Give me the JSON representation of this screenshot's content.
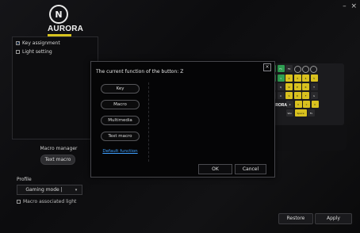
{
  "brand": {
    "logo_letter": "N",
    "name": "AURORA",
    "accent": "#d7c31f"
  },
  "window": {
    "minimize": "–",
    "close": "×"
  },
  "options": [
    {
      "label": "Key assignment",
      "checked": true
    },
    {
      "label": "Light setting",
      "checked": false
    }
  ],
  "macro_manager": {
    "title": "Macro manager",
    "button": "Text macro"
  },
  "profile": {
    "label": "Profile",
    "selected": "Gaming mode |",
    "chevron": "▾"
  },
  "macro_light": {
    "label": "Macro associated light",
    "checked": false
  },
  "footer": {
    "restore": "Restore",
    "apply": "Apply"
  },
  "dialog": {
    "title": "The current function of the button: Z",
    "close": "×",
    "functions": [
      "Key",
      "Macro",
      "Multimedia",
      "Text macro",
      "Default function"
    ],
    "active_function": "Default function",
    "ok": "OK",
    "cancel": "Cancel"
  },
  "keyboard": {
    "brand": "AURORA",
    "row1": [
      "Esc",
      "F1",
      "F2",
      "F3",
      "F4",
      "F5"
    ],
    "row2": [
      "~",
      "1",
      "2",
      "3",
      "4",
      "5"
    ],
    "row3": [
      "Tab",
      "Q",
      "W",
      "E",
      "R",
      "T"
    ],
    "row4": [
      "Caps",
      "A",
      "S",
      "D",
      "F",
      "G"
    ],
    "row5": [
      "Shift",
      "Z",
      "X",
      "C",
      "V",
      "B"
    ],
    "row6": [
      "Ctrl",
      "Win",
      "Alt",
      "Space",
      "Fn"
    ]
  }
}
